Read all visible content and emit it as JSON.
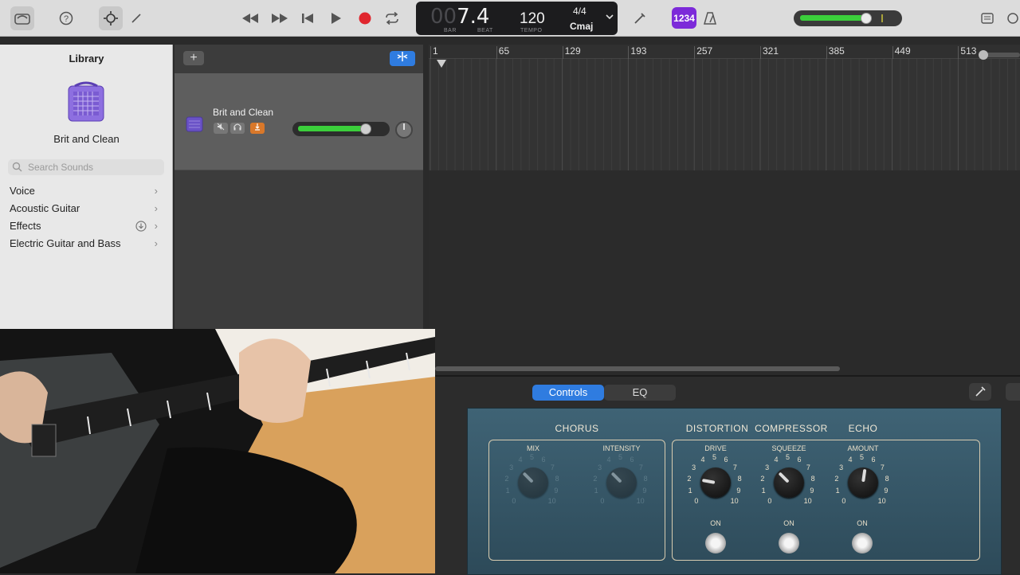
{
  "toolbar": {
    "lcd": {
      "bar": "7",
      "bar_dim": "00",
      "beat": "4",
      "bar_label": "BAR",
      "beat_label": "BEAT",
      "tempo": "120",
      "tempo_label": "TEMPO",
      "signature": "4/4",
      "key": "Cmaj"
    },
    "count_in": "1234",
    "master_volume_fraction": 0.66
  },
  "library": {
    "title": "Library",
    "patch_name": "Brit and Clean",
    "search_placeholder": "Search Sounds",
    "items": [
      {
        "label": "Voice",
        "has_download": false
      },
      {
        "label": "Acoustic Guitar",
        "has_download": false
      },
      {
        "label": "Effects",
        "has_download": true
      },
      {
        "label": "Electric Guitar and Bass",
        "has_download": false
      }
    ]
  },
  "tracks": {
    "add_label": "+",
    "track": {
      "name": "Brit and Clean",
      "volume_fraction": 0.76
    }
  },
  "timeline": {
    "ruler": [
      "1",
      "65",
      "129",
      "193",
      "257",
      "321",
      "385",
      "449",
      "513"
    ]
  },
  "smart_controls": {
    "tabs": [
      {
        "label": "Controls",
        "active": true
      },
      {
        "label": "EQ",
        "active": false
      }
    ],
    "sections": {
      "chorus": "CHORUS",
      "distortion": "DISTORTION",
      "compressor": "COMPRESSOR",
      "echo": "ECHO"
    },
    "knobs": {
      "mix": {
        "label": "MIX",
        "value": 3,
        "enabled": false
      },
      "intensity": {
        "label": "INTENSITY",
        "value": 3,
        "enabled": false
      },
      "drive": {
        "label": "DRIVE",
        "value": 2.5,
        "enabled": true
      },
      "squeeze": {
        "label": "SQUEEZE",
        "value": 3,
        "enabled": true
      },
      "amount": {
        "label": "AMOUNT",
        "value": 5.5,
        "enabled": true
      }
    },
    "toggles": [
      "ON",
      "ON",
      "ON"
    ]
  },
  "colors": {
    "accent": "#2f7ce0",
    "record": "#e0262e",
    "meter": "#3bcf3b",
    "count_in": "#7c2ad9"
  }
}
